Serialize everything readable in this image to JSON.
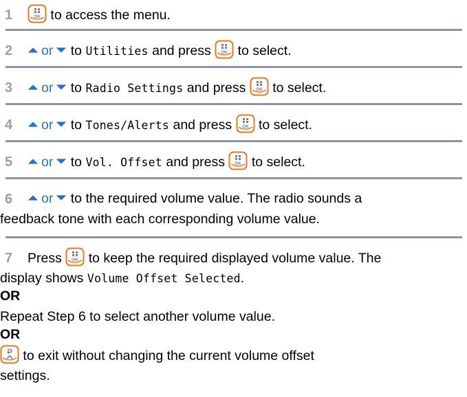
{
  "steps": [
    {
      "num": "1",
      "text_a": "to access the menu."
    },
    {
      "num": "2",
      "or": "or",
      "to": "to",
      "item": "Utilities",
      "and_press": "and press",
      "select": "to select."
    },
    {
      "num": "3",
      "or": "or",
      "to": "to",
      "item": "Radio Settings",
      "and_press": "and press",
      "select": "to select."
    },
    {
      "num": "4",
      "or": "or",
      "to": "to",
      "item": "Tones/Alerts",
      "and_press": "and press",
      "select": "to select."
    },
    {
      "num": "5",
      "or": "or",
      "to": "to",
      "item": "Vol. Offset",
      "and_press": "and press",
      "select": "to select."
    },
    {
      "num": "6",
      "or": "or",
      "line1": "to the required volume value. The radio sounds a",
      "line2": "feedback tone with each corresponding volume value."
    },
    {
      "num": "7",
      "press": "Press",
      "line1_rest": "to keep the required displayed volume value. The",
      "line2_a": "display shows",
      "line2_mono": "Volume Offset Selected",
      "line2_end": ".",
      "or1": "OR",
      "repeat": "Repeat Step 6 to select another volume value.",
      "or2": "OR",
      "exit1": "to exit without changing the current volume offset",
      "exit2": "settings."
    }
  ],
  "icons": {
    "ok_button": "menu-ok-button-icon",
    "back_button": "back-home-button-icon",
    "up_arrow": "up-arrow-icon",
    "down_arrow": "down-arrow-icon"
  },
  "colors": {
    "step_number": "#9aa0a9",
    "or_text": "#2a72c6",
    "arrow": "#2a72c6",
    "rule": "#8a95a3",
    "button_stroke": "#e87722"
  }
}
